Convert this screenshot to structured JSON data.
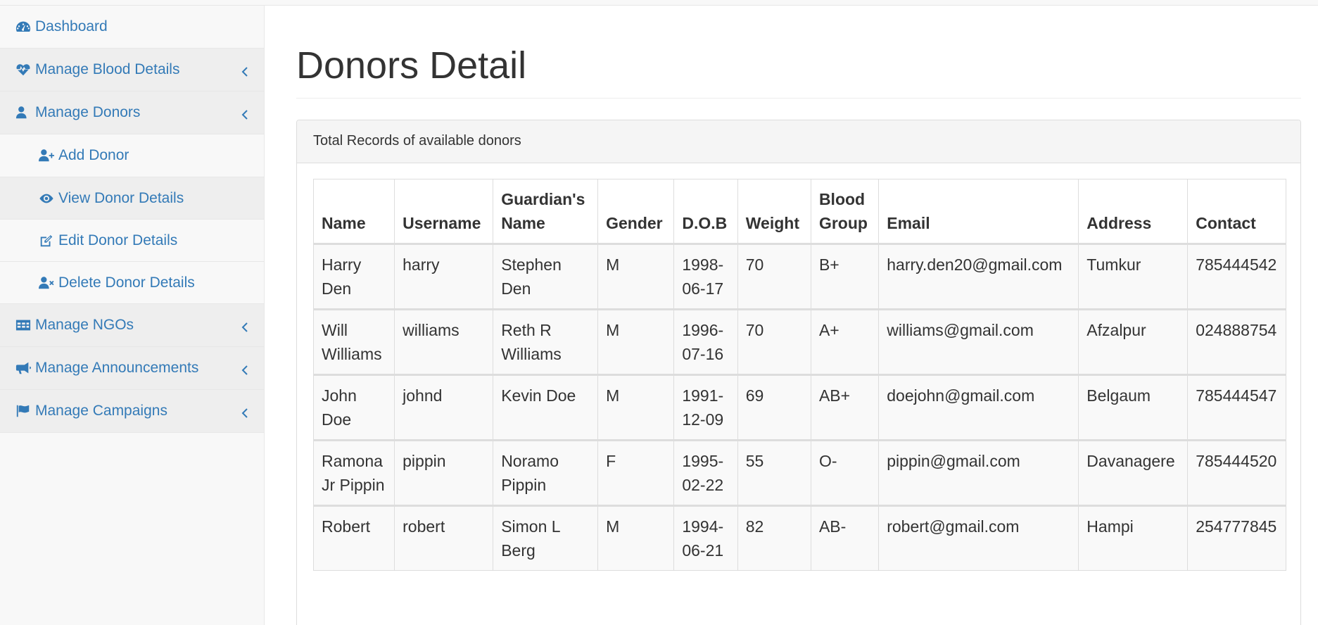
{
  "sidebar": {
    "items": [
      {
        "label": "Dashboard",
        "icon": "dashboard-icon"
      },
      {
        "label": "Manage Blood Details",
        "icon": "heartbeat-icon"
      },
      {
        "label": "Manage Donors",
        "icon": "user-icon"
      },
      {
        "label": "Manage NGOs",
        "icon": "table-icon"
      },
      {
        "label": "Manage Announcements",
        "icon": "bullhorn-icon"
      },
      {
        "label": "Manage Campaigns",
        "icon": "flag-icon"
      }
    ],
    "donor_subitems": [
      {
        "label": "Add Donor",
        "icon": "user-plus-icon"
      },
      {
        "label": "View Donor Details",
        "icon": "eye-icon"
      },
      {
        "label": "Edit Donor Details",
        "icon": "edit-icon"
      },
      {
        "label": "Delete Donor Details",
        "icon": "user-times-icon"
      }
    ]
  },
  "main": {
    "title": "Donors Detail",
    "panel_heading": "Total Records of available donors"
  },
  "table": {
    "headers": [
      "Name",
      "Username",
      "Guardian's Name",
      "Gender",
      "D.O.B",
      "Weight",
      "Blood Group",
      "Email",
      "Address",
      "Contact"
    ],
    "rows": [
      [
        "Harry Den",
        "harry",
        "Stephen Den",
        "M",
        "1998-06-17",
        "70",
        "B+",
        "harry.den20@gmail.com",
        "Tumkur",
        "785444542"
      ],
      [
        "Will Williams",
        "williams",
        "Reth R Williams",
        "M",
        "1996-07-16",
        "70",
        "A+",
        "williams@gmail.com",
        "Afzalpur",
        "024888754"
      ],
      [
        "John Doe",
        "johnd",
        "Kevin Doe",
        "M",
        "1991-12-09",
        "69",
        "AB+",
        "doejohn@gmail.com",
        "Belgaum",
        "785444547"
      ],
      [
        "Ramona Jr Pippin",
        "pippin",
        "Noramo Pippin",
        "F",
        "1995-02-22",
        "55",
        "O-",
        "pippin@gmail.com",
        "Davanagere",
        "785444520"
      ],
      [
        "Robert",
        "robert",
        "Simon L Berg",
        "M",
        "1994-06-21",
        "82",
        "AB-",
        "robert@gmail.com",
        "Hampi",
        "254777845"
      ]
    ]
  },
  "colors": {
    "link": "#337ab7",
    "sidebar_bg": "#f8f8f8",
    "active_bg": "#eeeeee",
    "border": "#dddddd"
  }
}
